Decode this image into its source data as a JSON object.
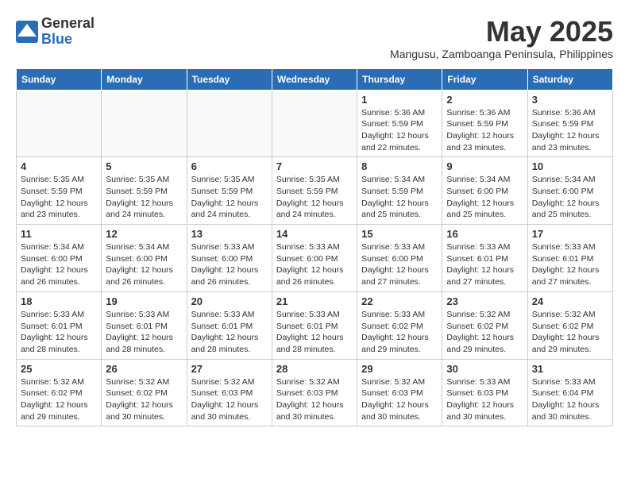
{
  "logo": {
    "general": "General",
    "blue": "Blue"
  },
  "title": "May 2025",
  "location": "Mangusu, Zamboanga Peninsula, Philippines",
  "weekdays": [
    "Sunday",
    "Monday",
    "Tuesday",
    "Wednesday",
    "Thursday",
    "Friday",
    "Saturday"
  ],
  "weeks": [
    [
      {
        "day": "",
        "info": ""
      },
      {
        "day": "",
        "info": ""
      },
      {
        "day": "",
        "info": ""
      },
      {
        "day": "",
        "info": ""
      },
      {
        "day": "1",
        "info": "Sunrise: 5:36 AM\nSunset: 5:59 PM\nDaylight: 12 hours\nand 22 minutes."
      },
      {
        "day": "2",
        "info": "Sunrise: 5:36 AM\nSunset: 5:59 PM\nDaylight: 12 hours\nand 23 minutes."
      },
      {
        "day": "3",
        "info": "Sunrise: 5:36 AM\nSunset: 5:59 PM\nDaylight: 12 hours\nand 23 minutes."
      }
    ],
    [
      {
        "day": "4",
        "info": "Sunrise: 5:35 AM\nSunset: 5:59 PM\nDaylight: 12 hours\nand 23 minutes."
      },
      {
        "day": "5",
        "info": "Sunrise: 5:35 AM\nSunset: 5:59 PM\nDaylight: 12 hours\nand 24 minutes."
      },
      {
        "day": "6",
        "info": "Sunrise: 5:35 AM\nSunset: 5:59 PM\nDaylight: 12 hours\nand 24 minutes."
      },
      {
        "day": "7",
        "info": "Sunrise: 5:35 AM\nSunset: 5:59 PM\nDaylight: 12 hours\nand 24 minutes."
      },
      {
        "day": "8",
        "info": "Sunrise: 5:34 AM\nSunset: 5:59 PM\nDaylight: 12 hours\nand 25 minutes."
      },
      {
        "day": "9",
        "info": "Sunrise: 5:34 AM\nSunset: 6:00 PM\nDaylight: 12 hours\nand 25 minutes."
      },
      {
        "day": "10",
        "info": "Sunrise: 5:34 AM\nSunset: 6:00 PM\nDaylight: 12 hours\nand 25 minutes."
      }
    ],
    [
      {
        "day": "11",
        "info": "Sunrise: 5:34 AM\nSunset: 6:00 PM\nDaylight: 12 hours\nand 26 minutes."
      },
      {
        "day": "12",
        "info": "Sunrise: 5:34 AM\nSunset: 6:00 PM\nDaylight: 12 hours\nand 26 minutes."
      },
      {
        "day": "13",
        "info": "Sunrise: 5:33 AM\nSunset: 6:00 PM\nDaylight: 12 hours\nand 26 minutes."
      },
      {
        "day": "14",
        "info": "Sunrise: 5:33 AM\nSunset: 6:00 PM\nDaylight: 12 hours\nand 26 minutes."
      },
      {
        "day": "15",
        "info": "Sunrise: 5:33 AM\nSunset: 6:00 PM\nDaylight: 12 hours\nand 27 minutes."
      },
      {
        "day": "16",
        "info": "Sunrise: 5:33 AM\nSunset: 6:01 PM\nDaylight: 12 hours\nand 27 minutes."
      },
      {
        "day": "17",
        "info": "Sunrise: 5:33 AM\nSunset: 6:01 PM\nDaylight: 12 hours\nand 27 minutes."
      }
    ],
    [
      {
        "day": "18",
        "info": "Sunrise: 5:33 AM\nSunset: 6:01 PM\nDaylight: 12 hours\nand 28 minutes."
      },
      {
        "day": "19",
        "info": "Sunrise: 5:33 AM\nSunset: 6:01 PM\nDaylight: 12 hours\nand 28 minutes."
      },
      {
        "day": "20",
        "info": "Sunrise: 5:33 AM\nSunset: 6:01 PM\nDaylight: 12 hours\nand 28 minutes."
      },
      {
        "day": "21",
        "info": "Sunrise: 5:33 AM\nSunset: 6:01 PM\nDaylight: 12 hours\nand 28 minutes."
      },
      {
        "day": "22",
        "info": "Sunrise: 5:33 AM\nSunset: 6:02 PM\nDaylight: 12 hours\nand 29 minutes."
      },
      {
        "day": "23",
        "info": "Sunrise: 5:32 AM\nSunset: 6:02 PM\nDaylight: 12 hours\nand 29 minutes."
      },
      {
        "day": "24",
        "info": "Sunrise: 5:32 AM\nSunset: 6:02 PM\nDaylight: 12 hours\nand 29 minutes."
      }
    ],
    [
      {
        "day": "25",
        "info": "Sunrise: 5:32 AM\nSunset: 6:02 PM\nDaylight: 12 hours\nand 29 minutes."
      },
      {
        "day": "26",
        "info": "Sunrise: 5:32 AM\nSunset: 6:02 PM\nDaylight: 12 hours\nand 30 minutes."
      },
      {
        "day": "27",
        "info": "Sunrise: 5:32 AM\nSunset: 6:03 PM\nDaylight: 12 hours\nand 30 minutes."
      },
      {
        "day": "28",
        "info": "Sunrise: 5:32 AM\nSunset: 6:03 PM\nDaylight: 12 hours\nand 30 minutes."
      },
      {
        "day": "29",
        "info": "Sunrise: 5:32 AM\nSunset: 6:03 PM\nDaylight: 12 hours\nand 30 minutes."
      },
      {
        "day": "30",
        "info": "Sunrise: 5:33 AM\nSunset: 6:03 PM\nDaylight: 12 hours\nand 30 minutes."
      },
      {
        "day": "31",
        "info": "Sunrise: 5:33 AM\nSunset: 6:04 PM\nDaylight: 12 hours\nand 30 minutes."
      }
    ]
  ]
}
